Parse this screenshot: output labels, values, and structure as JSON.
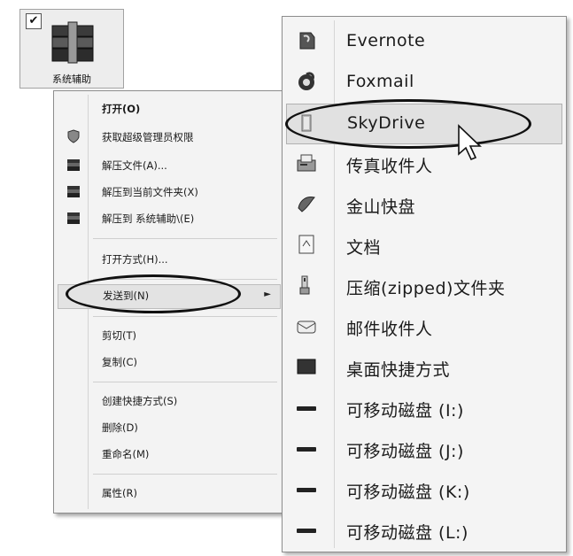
{
  "desktop_icon": {
    "label": "系统辅助",
    "checked": true,
    "check_glyph": "✔",
    "icon": "winrar-archive-icon"
  },
  "context_menu": {
    "items": [
      {
        "label": "打开(O)",
        "icon": null
      },
      {
        "label": "获取超级管理员权限",
        "icon": "shield-icon"
      },
      {
        "label": "解压文件(A)...",
        "icon": "winrar-icon"
      },
      {
        "label": "解压到当前文件夹(X)",
        "icon": "winrar-icon"
      },
      {
        "label": "解压到 系统辅助\\(E)",
        "icon": "winrar-icon"
      },
      {
        "label": "打开方式(H)...",
        "icon": null
      },
      {
        "label": "发送到(N)",
        "icon": null,
        "submenu": true,
        "highlighted": true,
        "submenu_arrow": "►"
      },
      {
        "label": "剪切(T)",
        "icon": null
      },
      {
        "label": "复制(C)",
        "icon": null
      },
      {
        "label": "创建快捷方式(S)",
        "icon": null
      },
      {
        "label": "删除(D)",
        "icon": null
      },
      {
        "label": "重命名(M)",
        "icon": null
      },
      {
        "label": "属性(R)",
        "icon": null
      }
    ]
  },
  "send_to_menu": {
    "items": [
      {
        "label": "Evernote",
        "icon": "evernote-icon"
      },
      {
        "label": "Foxmail",
        "icon": "foxmail-icon"
      },
      {
        "label": "SkyDrive",
        "icon": "skydrive-icon",
        "highlighted": true
      },
      {
        "label": "传真收件人",
        "icon": "fax-icon"
      },
      {
        "label": "金山快盘",
        "icon": "kuaipan-icon"
      },
      {
        "label": "文档",
        "icon": "documents-icon"
      },
      {
        "label": "压缩(zipped)文件夹",
        "icon": "zip-folder-icon"
      },
      {
        "label": "邮件收件人",
        "icon": "mail-recipient-icon"
      },
      {
        "label": "桌面快捷方式",
        "icon": "desktop-icon"
      },
      {
        "label": "可移动磁盘 (I:)",
        "icon": "removable-disk-icon"
      },
      {
        "label": "可移动磁盘 (J:)",
        "icon": "removable-disk-icon"
      },
      {
        "label": "可移动磁盘 (K:)",
        "icon": "removable-disk-icon"
      },
      {
        "label": "可移动磁盘 (L:)",
        "icon": "removable-disk-icon"
      }
    ]
  },
  "colors": {
    "menu_bg": "#f3f3f3",
    "highlight": "#dde2e8",
    "annotation": "#111111"
  }
}
